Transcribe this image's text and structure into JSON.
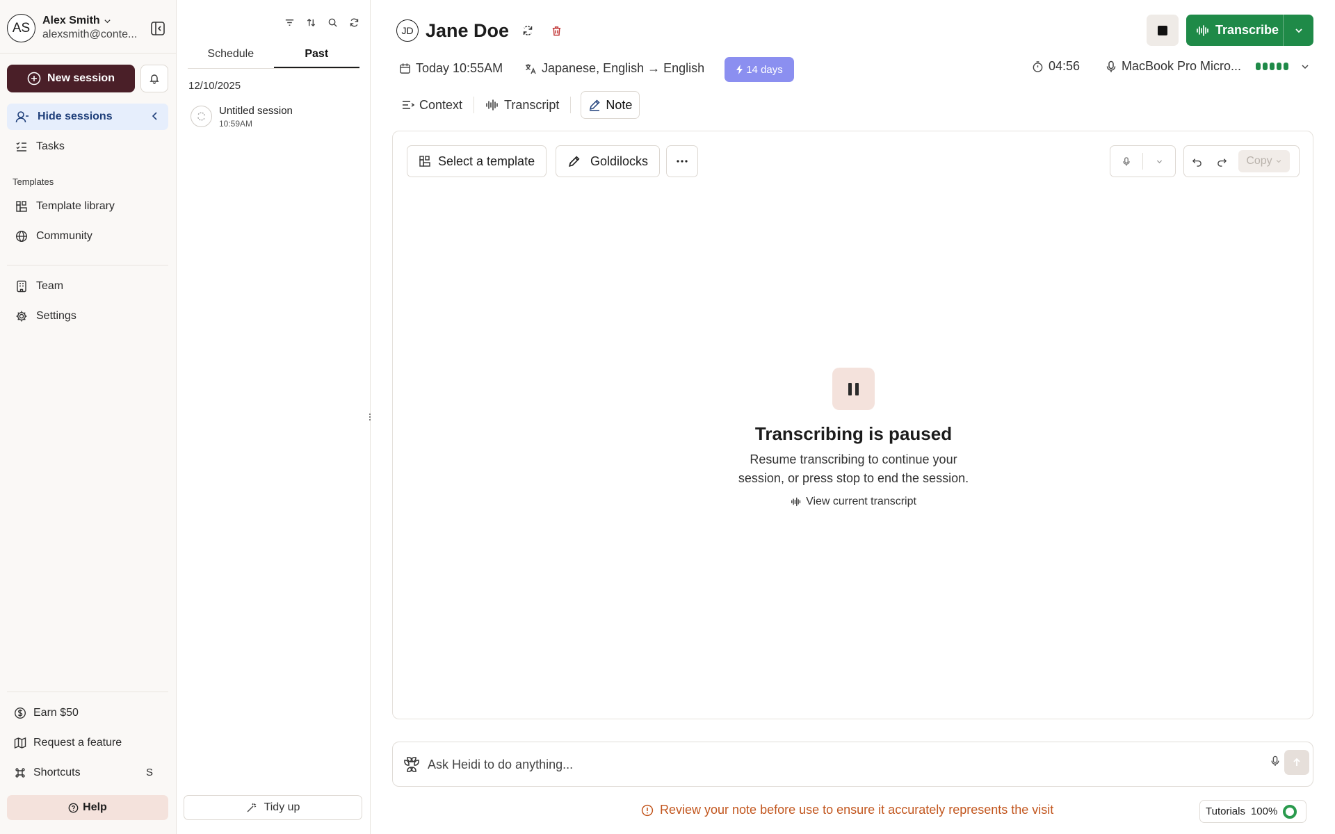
{
  "colors": {
    "primary_dark": "#4a1f28",
    "transcribe_green": "#1f8a48",
    "trial_purple": "#8b8ff0",
    "active_nav_bg": "#e6eefc",
    "warning_orange": "#c2561e",
    "delete_red": "#c33a3a"
  },
  "user": {
    "initials": "AS",
    "name": "Alex Smith",
    "email": "alexsmith@conte..."
  },
  "sidebar": {
    "new_session_label": "New session",
    "hide_sessions_label": "Hide sessions",
    "tasks_label": "Tasks",
    "templates_section_label": "Templates",
    "template_library_label": "Template library",
    "community_label": "Community",
    "team_label": "Team",
    "settings_label": "Settings",
    "earn_label": "Earn $50",
    "request_feature_label": "Request a feature",
    "shortcuts_label": "Shortcuts",
    "shortcuts_key": "S",
    "help_label": "Help"
  },
  "sessions_panel": {
    "tabs": [
      {
        "label": "Schedule",
        "active": false
      },
      {
        "label": "Past",
        "active": true
      }
    ],
    "date_group": "12/10/2025",
    "items": [
      {
        "title": "Untitled session",
        "time": "10:59AM"
      }
    ],
    "tidy_up_label": "Tidy up"
  },
  "session": {
    "patient_initials": "JD",
    "patient_name": "Jane Doe",
    "datetime": "Today 10:55AM",
    "languages": "Japanese, English → English",
    "trial_badge": "14 days",
    "timer": "04:56",
    "microphone": "MacBook Pro Micro...",
    "mic_level_bars": 5,
    "transcribe_label": "Transcribe"
  },
  "view_tabs": [
    {
      "label": "Context",
      "icon": "context-icon",
      "active": false
    },
    {
      "label": "Transcript",
      "icon": "waveform-icon",
      "active": false
    },
    {
      "label": "Note",
      "icon": "pencil-icon",
      "active": true
    }
  ],
  "note_toolbar": {
    "template_label": "Select a template",
    "style_label": "Goldilocks",
    "copy_label": "Copy"
  },
  "paused_state": {
    "title": "Transcribing is paused",
    "desc_line1": "Resume transcribing to continue your",
    "desc_line2": "session, or press stop to end the session.",
    "link_label": "View current transcript"
  },
  "ask_bar": {
    "placeholder": "Ask Heidi to do anything..."
  },
  "footer": {
    "warning": "Review your note before use to ensure it accurately represents the visit",
    "tutorials_label": "Tutorials",
    "tutorials_progress": "100%"
  }
}
